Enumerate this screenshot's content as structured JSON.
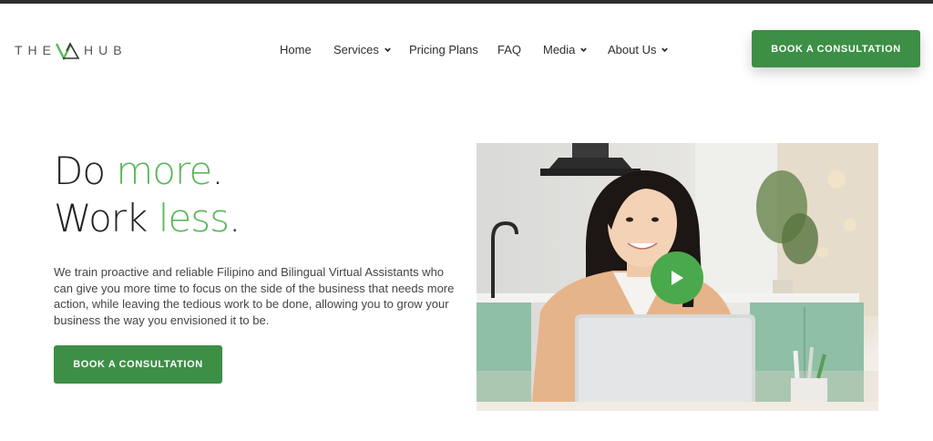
{
  "header": {
    "logo_text_left": "THE",
    "logo_text_right": "HUB",
    "logo_icon": "va-triangle-icon",
    "nav": [
      {
        "label": "Home",
        "has_dropdown": false
      },
      {
        "label": "Services",
        "has_dropdown": true
      },
      {
        "label": "Pricing Plans",
        "has_dropdown": false
      },
      {
        "label": "FAQ",
        "has_dropdown": false
      },
      {
        "label": "Media",
        "has_dropdown": true
      },
      {
        "label": "About Us",
        "has_dropdown": true
      }
    ],
    "cta_label": "BOOK A CONSULTATION"
  },
  "hero": {
    "line1_plain": "Do ",
    "line1_accent": "more",
    "line1_end": ".",
    "line2_plain": "Work ",
    "line2_accent": "less",
    "line2_end": ".",
    "description": "We train proactive and reliable Filipino and Bilingual Virtual Assistants who can give you more time to focus on the side of the business that needs more action, while leaving the tedious work to be done, allowing you to grow your business the way you envisioned it to be.",
    "cta_label": "BOOK A CONSULTATION"
  },
  "video": {
    "play_icon": "play-icon"
  },
  "colors": {
    "brand_green": "#3d8f46",
    "accent_green": "#5ab85a",
    "play_green": "#4aa94d",
    "top_bar": "#2f2f2f"
  }
}
